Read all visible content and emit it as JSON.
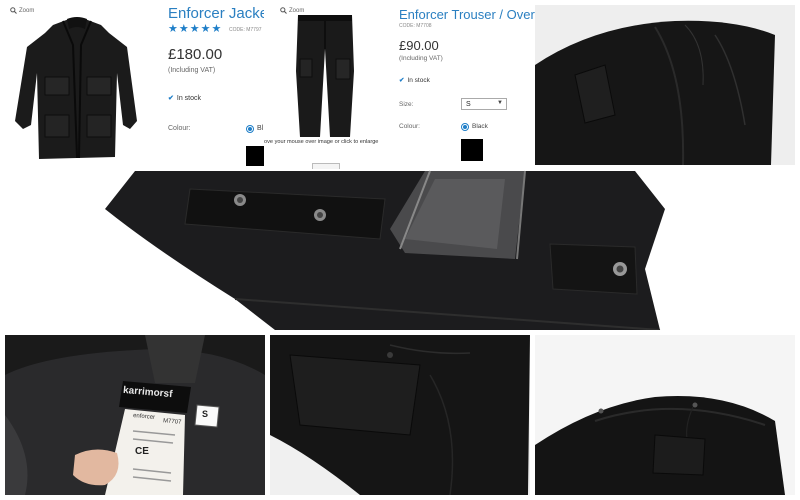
{
  "jacket_panel": {
    "zoom_label": "Zoom",
    "title": "Enforcer Jacket",
    "code": "CODE: M7797",
    "stars": "★★★★★",
    "price": "£180.00",
    "vat": "(Including VAT)",
    "stock": "In stock",
    "colour_label": "Colour:",
    "colour_value": "Bl"
  },
  "trouser_panel": {
    "zoom_label": "Zoom",
    "title": "Enforcer Trouser / Overtro",
    "code": "CODE: M7708",
    "price": "£90.00",
    "vat": "(Including VAT)",
    "stock": "In stock",
    "size_label": "Size:",
    "size_value": "S",
    "colour_label": "Colour:",
    "colour_value": "Black",
    "hover_hint": "ove your mouse over image or click to enlarge"
  },
  "label_photo": {
    "brand": "karrimor",
    "brand_suffix": "sf",
    "size_tag": "S",
    "product_line": "enforcer",
    "code": "M7707",
    "ce": "CE"
  },
  "colors": {
    "link_blue": "#2a7fc1",
    "fabric_black": "#111111",
    "background": "#ffffff"
  }
}
